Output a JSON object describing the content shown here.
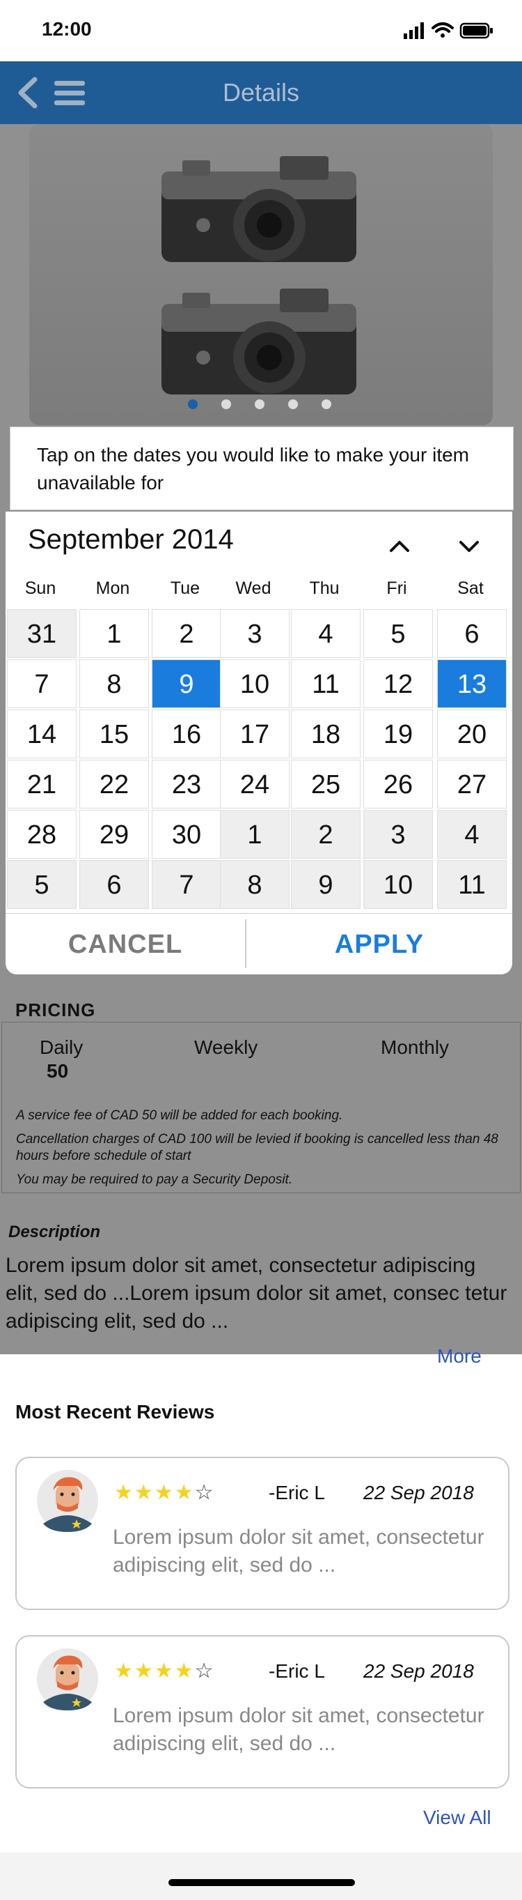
{
  "status_bar": {
    "time": "12:00"
  },
  "header": {
    "title": "Details"
  },
  "carousel": {
    "slide_count": 5,
    "active_index": 0
  },
  "calendar": {
    "instruction": "Tap on the dates you would like to make your item unavailable for",
    "month_label": "September 2014",
    "weekdays": [
      "Sun",
      "Mon",
      "Tue",
      "Wed",
      "Thu",
      "Fri",
      "Sat"
    ],
    "weeks": [
      [
        "31",
        "1",
        "2",
        "3",
        "4",
        "5",
        "6"
      ],
      [
        "7",
        "8",
        "9",
        "10",
        "11",
        "12",
        "13"
      ],
      [
        "14",
        "15",
        "16",
        "17",
        "18",
        "19",
        "20"
      ],
      [
        "21",
        "22",
        "23",
        "24",
        "25",
        "26",
        "27"
      ],
      [
        "28",
        "29",
        "30",
        "1",
        "2",
        "3",
        "4"
      ],
      [
        "5",
        "6",
        "7",
        "8",
        "9",
        "10",
        "11"
      ]
    ],
    "selected_days": [
      "9",
      "13"
    ],
    "cancel_label": "CANCEL",
    "apply_label": "APPLY"
  },
  "pricing": {
    "title": "PRICING",
    "columns": [
      {
        "label": "Daily",
        "value": "50"
      },
      {
        "label": "Weekly",
        "value": ""
      },
      {
        "label": "Monthly",
        "value": ""
      }
    ],
    "notes": [
      "A service fee of CAD 50 will be added for each booking.",
      "Cancellation charges of CAD 100 will be levied if booking is cancelled less than 48 hours before schedule of start",
      "You may be required to pay a Security Deposit."
    ]
  },
  "description": {
    "title": "Description",
    "text": "Lorem ipsum dolor sit amet, consectetur adipiscing elit, sed do ...Lorem ipsum dolor sit amet, consec tetur adipiscing elit, sed do ...",
    "more_label": "More"
  },
  "reviews": {
    "title": "Most Recent Reviews",
    "items": [
      {
        "rating": 4,
        "max_rating": 5,
        "author": "-Eric L",
        "date": "22 Sep 2018",
        "text": "Lorem ipsum dolor sit amet, consectetur adipiscing elit, sed do ..."
      },
      {
        "rating": 4,
        "max_rating": 5,
        "author": "-Eric L",
        "date": "22 Sep 2018",
        "text": "Lorem ipsum dolor sit amet, consectetur adipiscing elit, sed do ..."
      }
    ],
    "view_all_label": "View All"
  },
  "colors": {
    "header_bg": "#1f5c96",
    "accent": "#1a7dde",
    "link": "#2f55b5",
    "star": "#f4d21f",
    "overlay": "#909090"
  }
}
